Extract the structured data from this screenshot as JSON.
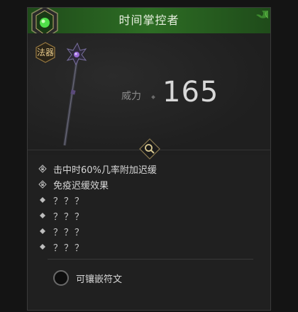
{
  "item": {
    "name": "时间掌控者",
    "type_badge": "法器",
    "stat_label": "威力",
    "stat_value": "165",
    "staff_icon": "staff-icon",
    "emblem_icon": "green-gem-emblem-icon",
    "inspect_icon": "magnifier-icon"
  },
  "affixes": [
    {
      "icon": "lock-icon",
      "text": "击中时60%几率附加迟缓"
    },
    {
      "icon": "lock-icon",
      "text": "免疫迟缓效果"
    },
    {
      "icon": "diamond-bullet-icon",
      "text": "？？？"
    },
    {
      "icon": "diamond-bullet-icon",
      "text": "？？？"
    },
    {
      "icon": "diamond-bullet-icon",
      "text": "？？？"
    },
    {
      "icon": "diamond-bullet-icon",
      "text": "？？？"
    }
  ],
  "socket": {
    "label": "可镶嵌符文"
  },
  "colors": {
    "header_green": "#2d6d24",
    "badge_gold": "#e6c889",
    "panel_bg": "#202020"
  }
}
